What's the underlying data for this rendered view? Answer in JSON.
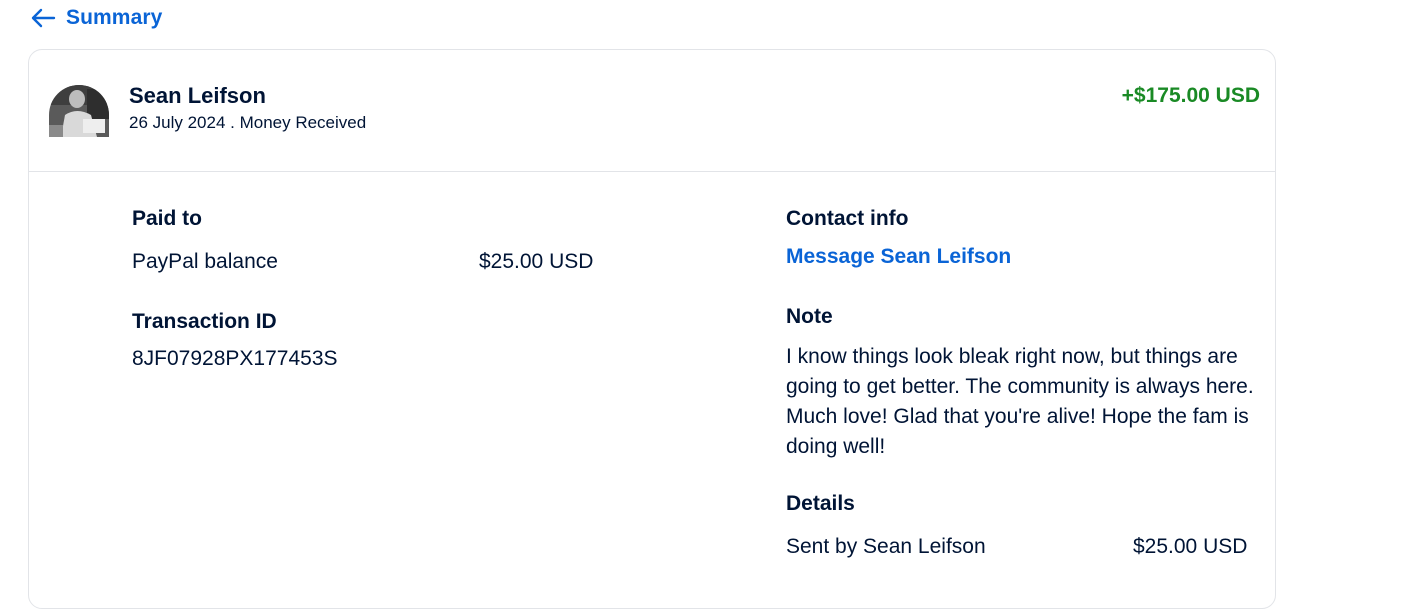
{
  "nav": {
    "back_label": "Summary",
    "back_icon": "arrow-left-icon"
  },
  "transaction": {
    "sender_name": "Sean Leifson",
    "meta": "26 July 2024 . Money Received",
    "amount": "+$175.00 USD",
    "amount_color": "#1a8a25"
  },
  "paid_to": {
    "title": "Paid to",
    "method": "PayPal balance",
    "amount": "$25.00 USD"
  },
  "transaction_id": {
    "title": "Transaction ID",
    "value": "8JF07928PX177453S"
  },
  "contact": {
    "title": "Contact info",
    "link": "Message Sean Leifson"
  },
  "note": {
    "title": "Note",
    "text": "I know things look bleak right now, but things are going to get better. The community is always here. Much love! Glad that you're alive! Hope the fam is doing well!"
  },
  "details": {
    "title": "Details",
    "row_label": "Sent by Sean Leifson",
    "row_value": "$25.00 USD"
  },
  "colors": {
    "link": "#0a64d6",
    "text": "#001435",
    "border": "#e2e4e8"
  }
}
